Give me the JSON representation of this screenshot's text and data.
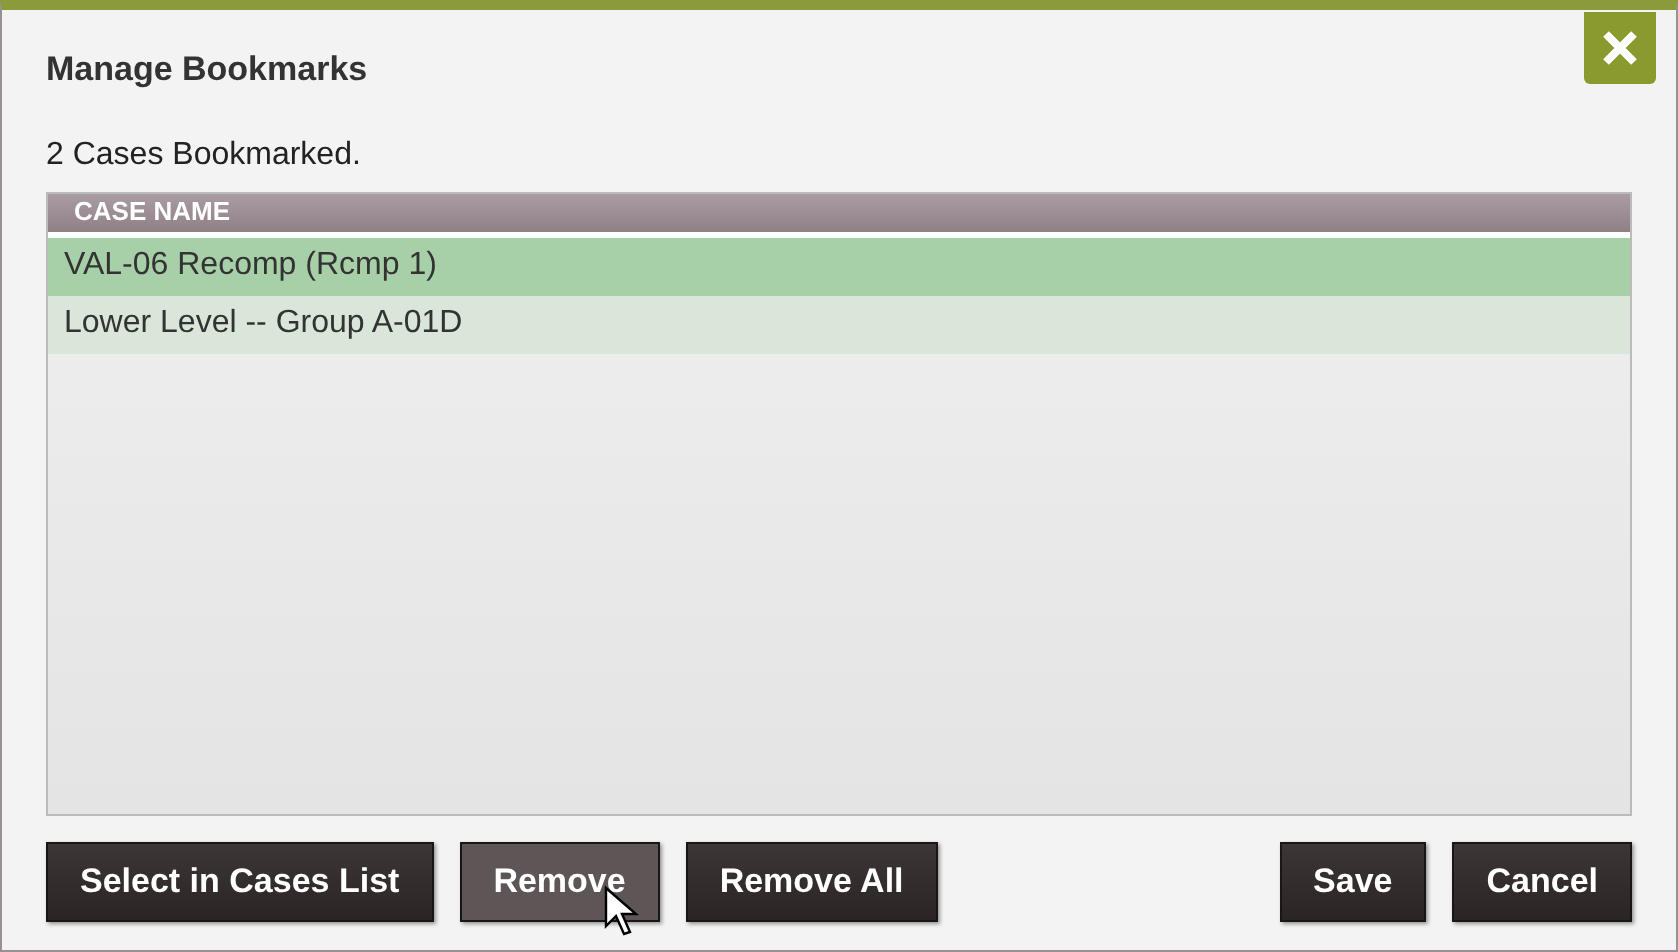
{
  "dialog": {
    "title": "Manage Bookmarks",
    "summary": "2 Cases Bookmarked."
  },
  "table": {
    "columns": [
      "CASE NAME"
    ],
    "rows": [
      {
        "name": "VAL-06 Recomp (Rcmp 1)",
        "selected": true
      },
      {
        "name": "Lower Level -- Group A-01D",
        "selected": false
      }
    ]
  },
  "buttons_left": [
    {
      "label": "Select in Cases List",
      "hovered": false
    },
    {
      "label": "Remove",
      "hovered": true
    },
    {
      "label": "Remove All",
      "hovered": false
    }
  ],
  "buttons_right": [
    {
      "label": "Save",
      "hovered": false
    },
    {
      "label": "Cancel",
      "hovered": false
    }
  ]
}
